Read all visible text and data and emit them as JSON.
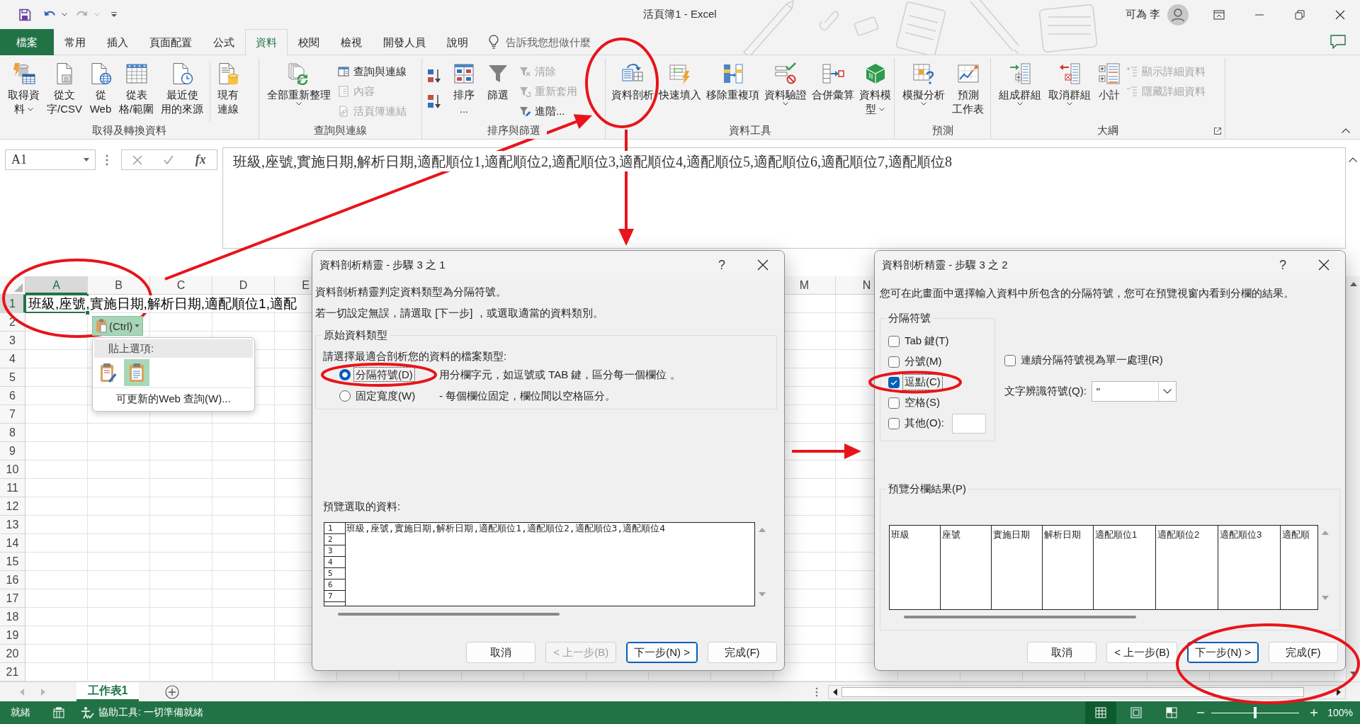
{
  "window": {
    "title": "活頁簿1 - Excel",
    "user": "可為 李"
  },
  "ribbon_tabs": [
    {
      "label": "檔案",
      "kind": "file",
      "selected": false
    },
    {
      "label": "常用",
      "kind": "tab",
      "selected": false
    },
    {
      "label": "插入",
      "kind": "tab",
      "selected": false
    },
    {
      "label": "頁面配置",
      "kind": "tab",
      "selected": false
    },
    {
      "label": "公式",
      "kind": "tab",
      "selected": false
    },
    {
      "label": "資料",
      "kind": "tab",
      "selected": true
    },
    {
      "label": "校閱",
      "kind": "tab",
      "selected": false
    },
    {
      "label": "檢視",
      "kind": "tab",
      "selected": false
    },
    {
      "label": "開發人員",
      "kind": "tab",
      "selected": false
    },
    {
      "label": "說明",
      "kind": "tab",
      "selected": false
    }
  ],
  "tell_me": {
    "placeholder": "告訴我您想做什麼"
  },
  "ribbon_groups": [
    {
      "label": "取得及轉換資料",
      "items": [
        {
          "kind": "large",
          "lines": [
            "取得資",
            "料"
          ],
          "dropdown": true
        },
        {
          "kind": "large",
          "lines": [
            "從文",
            "字/CSV"
          ]
        },
        {
          "kind": "large",
          "lines": [
            "從",
            "Web"
          ]
        },
        {
          "kind": "large",
          "lines": [
            "從表",
            "格/範圍"
          ]
        },
        {
          "kind": "large",
          "lines": [
            "最近使",
            "用的來源"
          ]
        },
        {
          "kind": "separator"
        },
        {
          "kind": "large",
          "lines": [
            "現有",
            "連線"
          ]
        }
      ]
    },
    {
      "label": "查詢與連線",
      "items": [
        {
          "kind": "large",
          "lines": [
            "全部重新整理"
          ],
          "dropdown": true
        },
        {
          "kind": "stack",
          "entries": [
            {
              "label": "查詢與連線",
              "disabled": false
            },
            {
              "label": "內容",
              "disabled": true
            },
            {
              "label": "活頁簿連結",
              "disabled": true
            }
          ]
        }
      ]
    },
    {
      "label": "排序與篩選",
      "items": [
        {
          "kind": "sort_buttons"
        },
        {
          "kind": "large",
          "lines": [
            "排序",
            "..."
          ]
        },
        {
          "kind": "large",
          "lines": [
            "篩選"
          ]
        },
        {
          "kind": "stack",
          "entries": [
            {
              "label": "清除",
              "disabled": true
            },
            {
              "label": "重新套用",
              "disabled": true
            },
            {
              "label": "進階...",
              "disabled": false
            }
          ]
        }
      ]
    },
    {
      "label": "資料工具",
      "items": [
        {
          "kind": "large",
          "lines": [
            "資料剖析"
          ]
        },
        {
          "kind": "large",
          "lines": [
            "快速填入"
          ]
        },
        {
          "kind": "large",
          "lines": [
            "移除重複項"
          ]
        },
        {
          "kind": "large",
          "lines": [
            "資料驗證"
          ],
          "dropdown": true
        },
        {
          "kind": "large",
          "lines": [
            "合併彙算"
          ]
        },
        {
          "kind": "large",
          "lines": [
            "資料模",
            "型"
          ],
          "dropdown": true
        }
      ]
    },
    {
      "label": "預測",
      "items": [
        {
          "kind": "large",
          "lines": [
            "模擬分析"
          ],
          "dropdown": true
        },
        {
          "kind": "large",
          "lines": [
            "預測",
            "工作表"
          ]
        }
      ]
    },
    {
      "label": "大綱",
      "launcher": true,
      "items": [
        {
          "kind": "large",
          "lines": [
            "組成群組"
          ],
          "dropdown": true
        },
        {
          "kind": "large",
          "lines": [
            "取消群組"
          ],
          "dropdown": true
        },
        {
          "kind": "large",
          "lines": [
            "小計"
          ]
        },
        {
          "kind": "stack",
          "entries": [
            {
              "label": "顯示詳細資料",
              "disabled": true
            },
            {
              "label": "隱藏詳細資料",
              "disabled": true
            }
          ]
        }
      ]
    }
  ],
  "formula_bar": {
    "name_box": "A1",
    "insert_function": "fx",
    "formula": "班級,座號,實施日期,解析日期,適配順位1,適配順位2,適配順位3,適配順位4,適配順位5,適配順位6,適配順位7,適配順位8"
  },
  "sheet": {
    "columns": [
      {
        "label": "A",
        "selected": true
      },
      {
        "label": "B",
        "selected": false
      },
      {
        "label": "C",
        "selected": false
      },
      {
        "label": "D",
        "selected": false
      },
      {
        "label": "E",
        "selected": false
      },
      {
        "label": "M",
        "selected": false
      },
      {
        "label": "N",
        "selected": false
      }
    ],
    "rows": [
      {
        "label": "1",
        "selected": true
      },
      {
        "label": "2",
        "selected": false
      },
      {
        "label": "3",
        "selected": false
      },
      {
        "label": "4",
        "selected": false
      },
      {
        "label": "5",
        "selected": false
      },
      {
        "label": "6",
        "selected": false
      },
      {
        "label": "7",
        "selected": false
      },
      {
        "label": "8",
        "selected": false
      },
      {
        "label": "9",
        "selected": false
      },
      {
        "label": "10",
        "selected": false
      },
      {
        "label": "11",
        "selected": false
      },
      {
        "label": "12",
        "selected": false
      },
      {
        "label": "13",
        "selected": false
      },
      {
        "label": "14",
        "selected": false
      },
      {
        "label": "15",
        "selected": false
      },
      {
        "label": "16",
        "selected": false
      },
      {
        "label": "17",
        "selected": false
      },
      {
        "label": "18",
        "selected": false
      },
      {
        "label": "19",
        "selected": false
      },
      {
        "label": "20",
        "selected": false
      },
      {
        "label": "21",
        "selected": false
      }
    ],
    "cell_text": "班級,座號,實施日期,解析日期,適配順位1,適配"
  },
  "paste_options": {
    "button_label": "(Ctrl)",
    "title": "貼上選項:",
    "options": [
      {
        "kind": "keep_source",
        "selected": false
      },
      {
        "kind": "text_only",
        "selected": true
      }
    ],
    "refreshable_query": "可更新的Web 查詢(W)..."
  },
  "dialogs": [
    {
      "kind": "type_step",
      "title": "資料剖析精靈 - 步驟 3 之 1",
      "help": "?",
      "intro": [
        "資料剖析精靈判定資料類型為分隔符號。",
        "若一切設定無誤，請選取 [下一步] ，或選取適當的資料類別。"
      ],
      "group_label": "原始資料類型",
      "prompt": "請選擇最適合剖析您的資料的檔案類型:",
      "file_types": [
        {
          "label": "分隔符號(D)",
          "description": "用分欄字元，如逗號或 TAB 鍵，區分每一個欄位 。",
          "selected": true,
          "focused": true
        },
        {
          "label": "固定寬度(W)",
          "description": "-  每個欄位固定，欄位間以空格區分。",
          "selected": false,
          "focused": false
        }
      ],
      "preview_label": "預覽選取的資料:",
      "preview_rows": [
        {
          "number": "1",
          "text": "班級,座號,實施日期,解析日期,適配順位1,適配順位2,適配順位3,適配順位4"
        },
        {
          "number": "2"
        },
        {
          "number": "3"
        },
        {
          "number": "4"
        },
        {
          "number": "5"
        },
        {
          "number": "6"
        },
        {
          "number": "7"
        }
      ],
      "buttons": [
        {
          "label": "取消",
          "disabled": false,
          "default": false
        },
        {
          "label": "< 上一步(B)",
          "disabled": true,
          "default": false
        },
        {
          "label": "下一步(N) >",
          "disabled": false,
          "default": true
        },
        {
          "label": "完成(F)",
          "disabled": false,
          "default": false
        }
      ]
    },
    {
      "kind": "delimiter_step",
      "title": "資料剖析精靈 - 步驟 3 之 2",
      "help": "?",
      "intro": [
        "您可在此畫面中選擇輸入資料中所包含的分隔符號，您可在預覽視窗內看到分欄的結果。"
      ],
      "group_label": "分隔符號",
      "delimiters": [
        {
          "label": "Tab 鍵(T)",
          "kind": "plain",
          "checked": false,
          "focused": false
        },
        {
          "label": "分號(M)",
          "kind": "plain",
          "checked": false,
          "focused": false
        },
        {
          "label": "逗點(C)",
          "kind": "plain",
          "checked": true,
          "focused": true
        },
        {
          "label": "空格(S)",
          "kind": "plain",
          "checked": false,
          "focused": false
        },
        {
          "label": "其他(O):",
          "kind": "other",
          "checked": false,
          "focused": false
        }
      ],
      "treat_consecutive": {
        "label": "連續分隔符號視為單一處理(R)",
        "checked": false
      },
      "text_qualifier": {
        "label": "文字辨識符號(Q):",
        "value": "\""
      },
      "preview_label": "預覽分欄結果(P)",
      "preview_columns": [
        "班級",
        "座號",
        "實施日期",
        "解析日期",
        "適配順位1",
        "適配順位2",
        "適配順位3",
        "適配順"
      ],
      "buttons": [
        {
          "label": "取消",
          "disabled": false,
          "default": false
        },
        {
          "label": "< 上一步(B)",
          "disabled": false,
          "default": false
        },
        {
          "label": "下一步(N) >",
          "disabled": false,
          "default": true
        },
        {
          "label": "完成(F)",
          "disabled": false,
          "default": false
        }
      ]
    }
  ],
  "sheet_tabs": [
    {
      "label": "工作表1",
      "selected": true
    }
  ],
  "status_bar": {
    "ready": "就緒",
    "accessibility": "協助工具: 一切準備就緒",
    "views": [
      {
        "kind": "normal",
        "selected": true
      },
      {
        "kind": "page_layout",
        "selected": false
      },
      {
        "kind": "page_break",
        "selected": false
      }
    ],
    "zoom": {
      "level": 0.5,
      "label": "100%"
    }
  }
}
